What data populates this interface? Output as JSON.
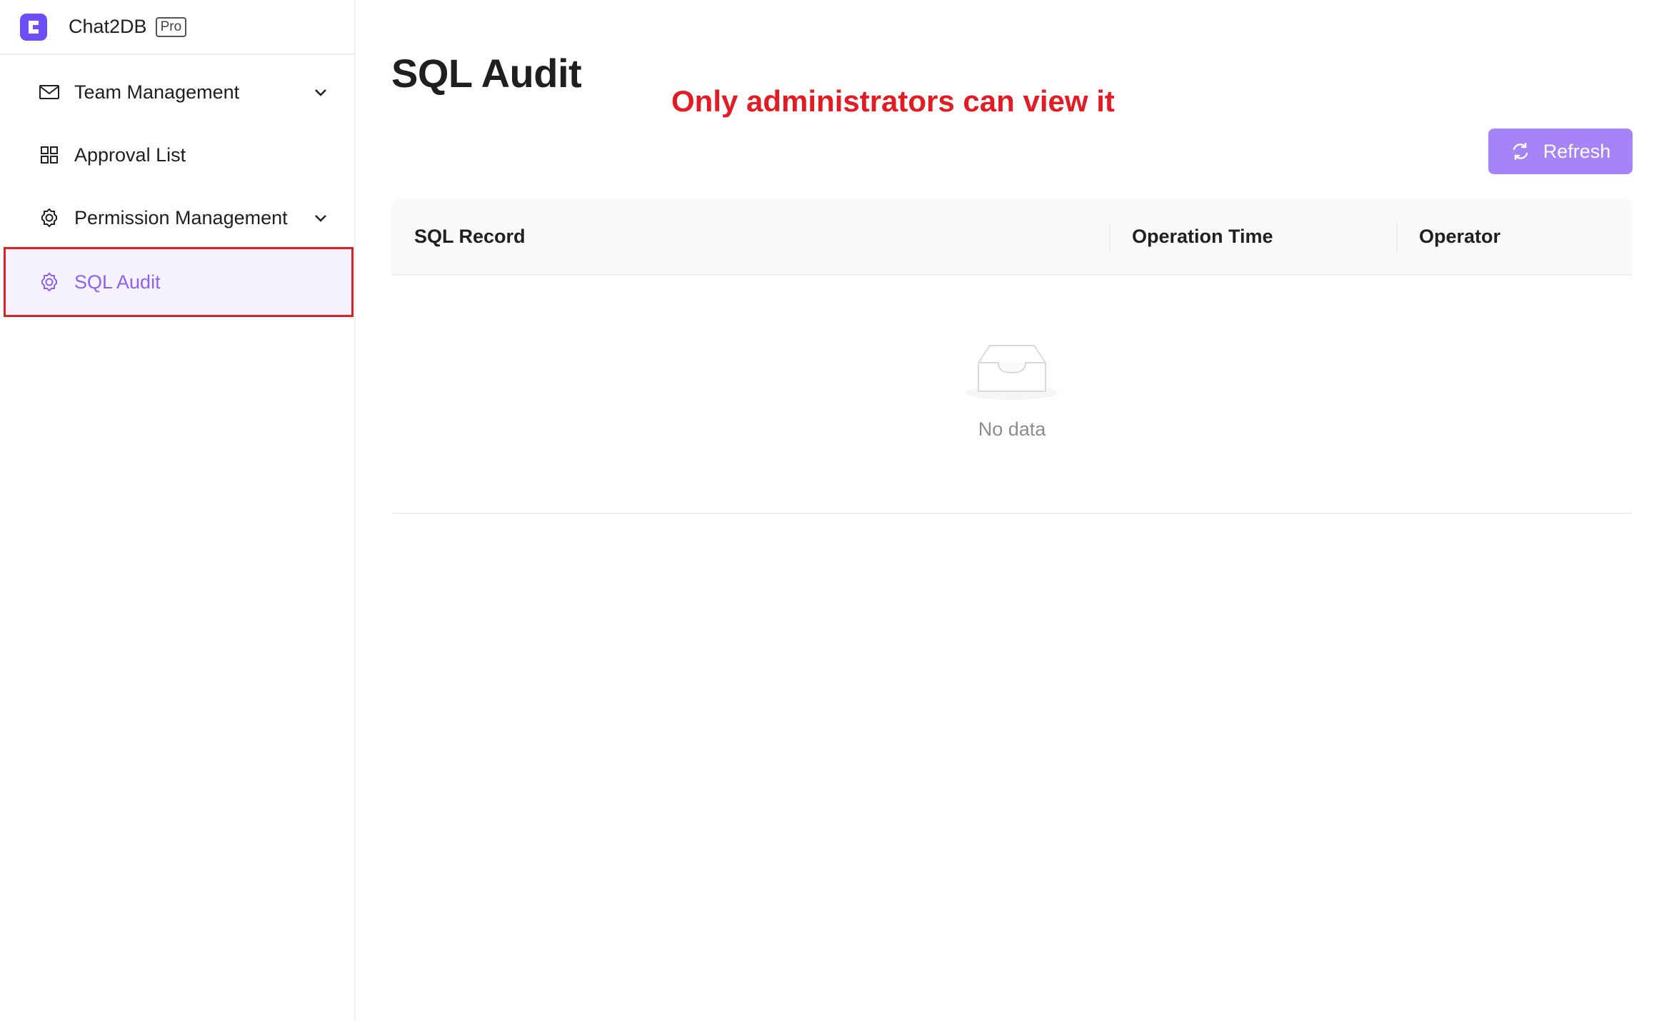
{
  "brand": {
    "name": "Chat2DB",
    "badge": "Pro",
    "accent": "#6b4ef5"
  },
  "sidebar": {
    "items": [
      {
        "label": "Team Management",
        "icon": "mail-icon",
        "has_submenu": true
      },
      {
        "label": "Approval List",
        "icon": "grid-icon",
        "has_submenu": false
      },
      {
        "label": "Permission Management",
        "icon": "gear-icon",
        "has_submenu": true
      },
      {
        "label": "SQL Audit",
        "icon": "gear-icon",
        "has_submenu": false,
        "active": true
      }
    ]
  },
  "main": {
    "title": "SQL Audit",
    "annotation": "Only administrators can view it",
    "refresh_label": "Refresh",
    "table": {
      "columns": [
        "SQL Record",
        "Operation Time",
        "Operator"
      ],
      "rows": [],
      "empty_text": "No data"
    }
  },
  "colors": {
    "accent": "#a683f7",
    "active_text": "#8c62f5",
    "active_bg": "#f6f2ff",
    "annotation": "#e31b23"
  }
}
